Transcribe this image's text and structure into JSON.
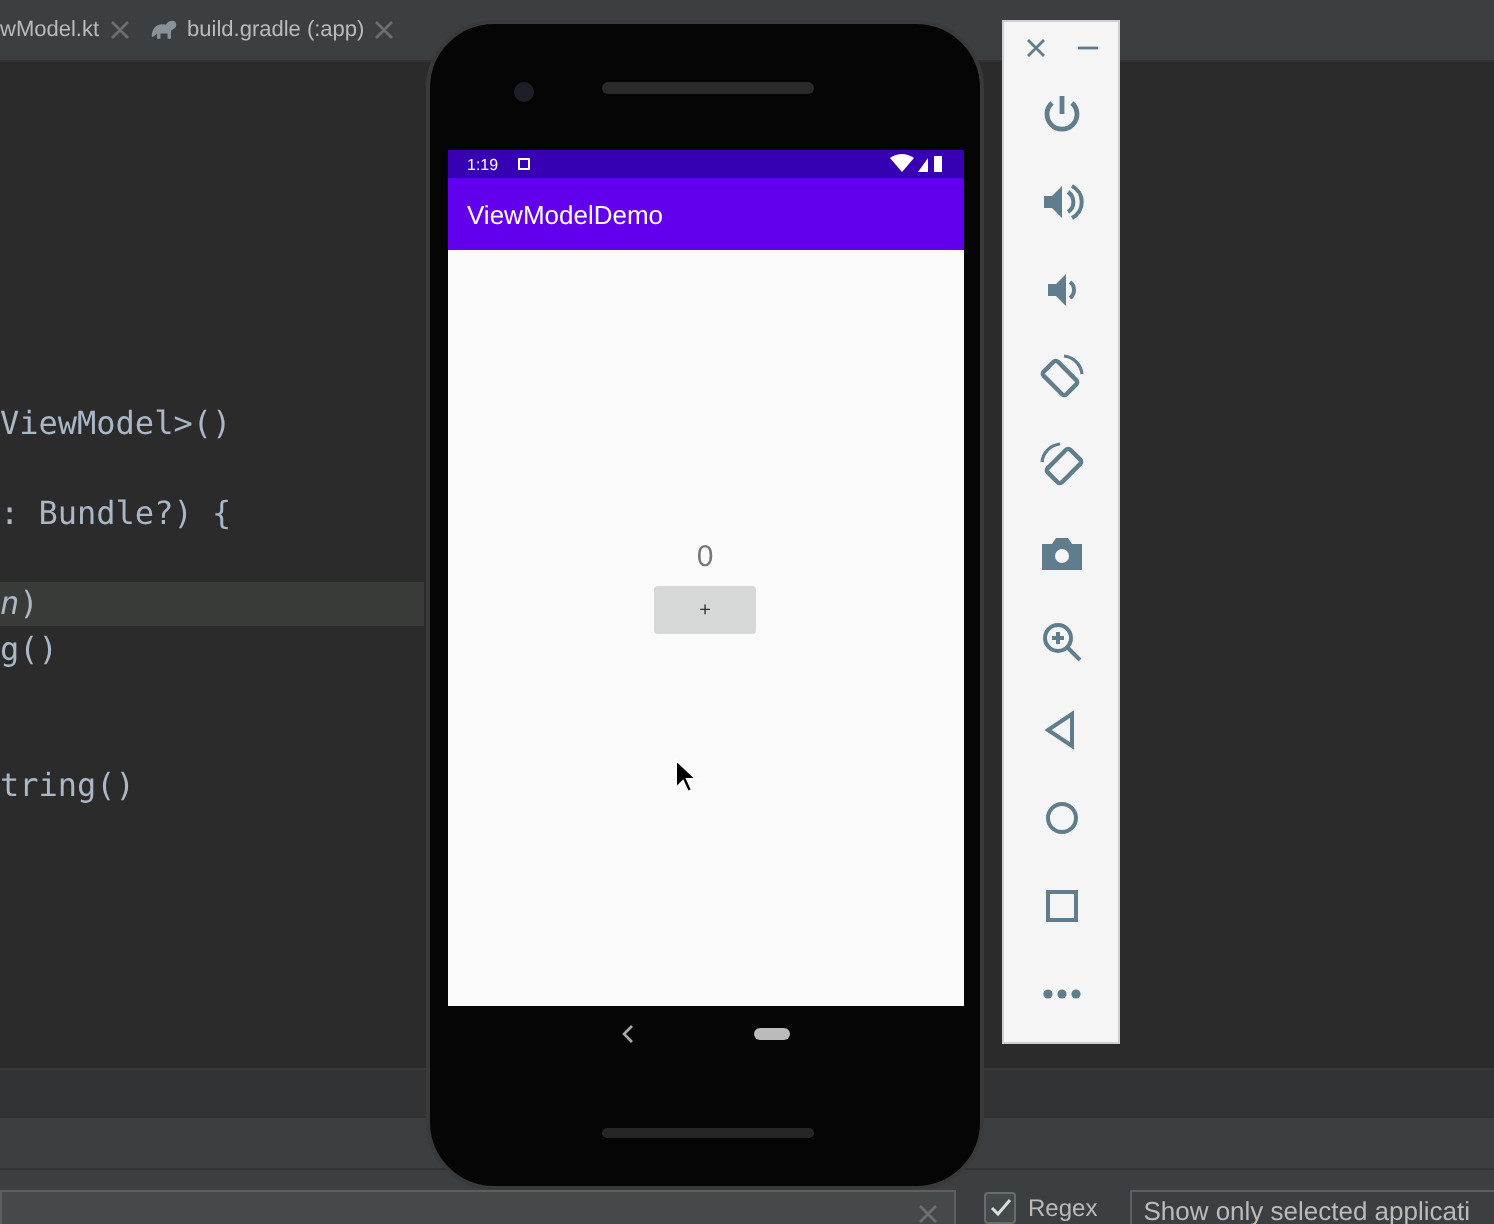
{
  "editor_tabs": [
    {
      "label": "wModel.kt",
      "selected": false
    },
    {
      "label": "build.gradle (:app)",
      "selected": false
    }
  ],
  "code_lines": [
    {
      "highlighted": false
    },
    {
      "highlighted": false
    },
    {
      "highlighted": false
    },
    {
      "highlighted": false
    },
    {
      "highlighted": false
    },
    {
      "highlighted": false
    },
    {
      "highlighted": false
    },
    {
      "text": "ViewModel>()",
      "highlighted": false
    },
    {
      "highlighted": false
    },
    {
      "text": ": Bundle?) {",
      "highlighted": false
    },
    {
      "highlighted": false
    },
    {
      "text": "*n*)",
      "highlighted": true
    },
    {
      "text": "g()",
      "highlighted": false
    },
    {
      "highlighted": false
    },
    {
      "highlighted": false
    },
    {
      "text": "tring()",
      "highlighted": false
    }
  ],
  "emulator": {
    "status_time": "1:19",
    "app_title": "ViewModelDemo",
    "counter": "0",
    "button_label": "+",
    "toolbar": [
      {
        "kind": "power"
      },
      {
        "kind": "volume-up"
      },
      {
        "kind": "volume-down"
      },
      {
        "kind": "rotate-left"
      },
      {
        "kind": "rotate-right"
      },
      {
        "kind": "camera"
      },
      {
        "kind": "zoom"
      },
      {
        "kind": "back"
      },
      {
        "kind": "home"
      },
      {
        "kind": "overview"
      },
      {
        "kind": "more"
      }
    ]
  },
  "bottom_bar": {
    "regex": {
      "label": "Regex",
      "checked": true
    },
    "filter": {
      "value": "Show only selected applicati"
    }
  }
}
